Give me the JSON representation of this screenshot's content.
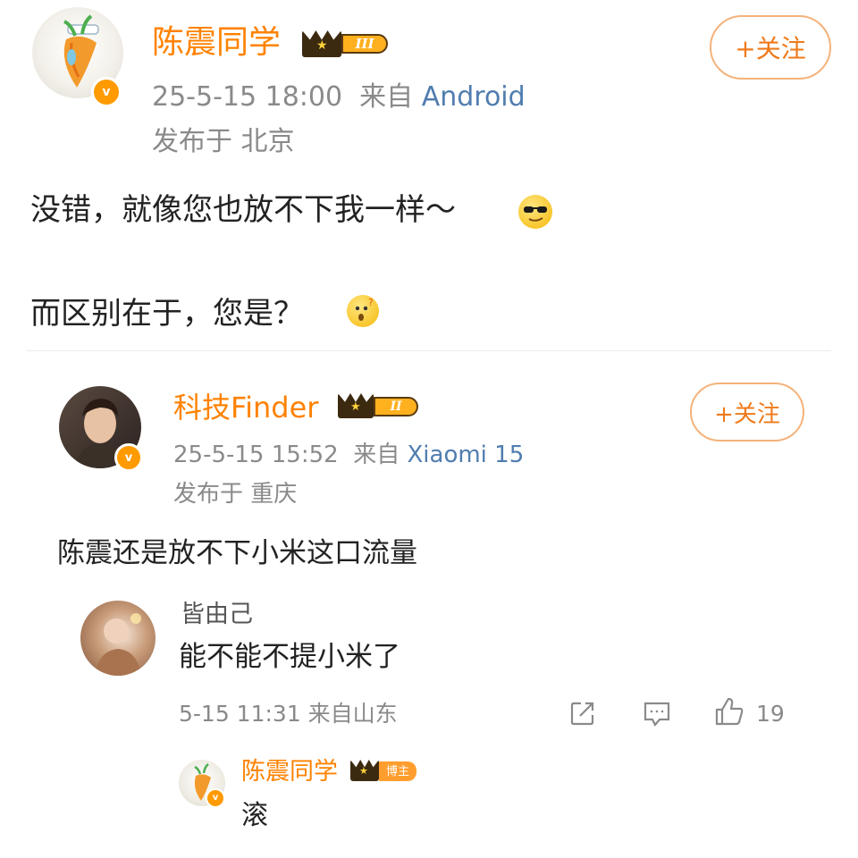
{
  "post": {
    "author": "陈震同学",
    "level": "III",
    "time": "25-5-15 18:00",
    "from_label": "来自",
    "source": "Android",
    "location": "发布于 北京",
    "follow_label": "+关注",
    "line1": "没错，就像您也放不下我一样～",
    "line2": "而区别在于，您是？"
  },
  "quoted": {
    "author": "科技Finder",
    "level": "II",
    "time": "25-5-15 15:52",
    "from_label": "来自",
    "source": "Xiaomi 15",
    "location": "发布于 重庆",
    "follow_label": "+关注",
    "text": "陈震还是放不下小米这口流量"
  },
  "comment": {
    "author": "皆由己",
    "text": "能不能不提小米了",
    "meta": "5-15 11:31 来自山东",
    "like_count": "19"
  },
  "reply": {
    "author": "陈震同学",
    "badge": "博主",
    "text": "滚"
  },
  "colors": {
    "accent": "#ff8200",
    "source_link": "#507daf",
    "meta_gray": "#8a8a8a",
    "verified_orange": "#ff9a00"
  },
  "icons": [
    "verified-badge-icon",
    "crown-icon",
    "cool-emoji-icon",
    "question-emoji-icon",
    "share-icon",
    "comment-icon",
    "like-icon"
  ]
}
